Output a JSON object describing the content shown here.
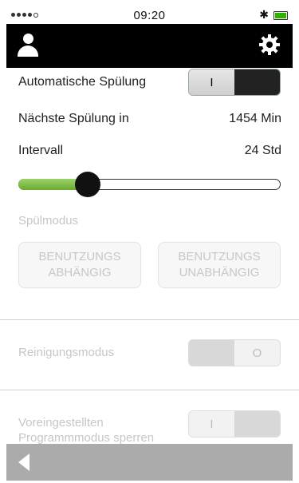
{
  "status_bar": {
    "time": "09:20"
  },
  "app_bar": {
    "user_icon": "user-icon",
    "settings_icon": "gear-icon"
  },
  "auto_flush": {
    "label": "Automatische Spülung",
    "toggle_on": "I",
    "state": "on"
  },
  "next_flush": {
    "label": "Nächste Spülung in",
    "value": "1454 Min"
  },
  "interval": {
    "label": "Intervall",
    "value": "24 Std",
    "slider_fraction": 0.27
  },
  "flush_mode": {
    "label": "Spülmodus",
    "options": [
      {
        "line1": "BENUTZUNGS",
        "line2": "ABHÄNGIG"
      },
      {
        "line1": "BENUTZUNGS",
        "line2": "UNABHÄNGIG"
      }
    ]
  },
  "cleaning_mode": {
    "label": "Reinigungsmodus",
    "toggle_off": "O"
  },
  "program_lock": {
    "label_line1": "Voreingestellten",
    "label_line2": "Programmmodus sperren",
    "toggle_on": "I"
  },
  "bottom_bar": {
    "back_icon": "back-arrow-icon"
  },
  "colors": {
    "slider_fill": "#7dbb45",
    "app_bar": "#000000",
    "bottom_bar": "#ababab"
  }
}
